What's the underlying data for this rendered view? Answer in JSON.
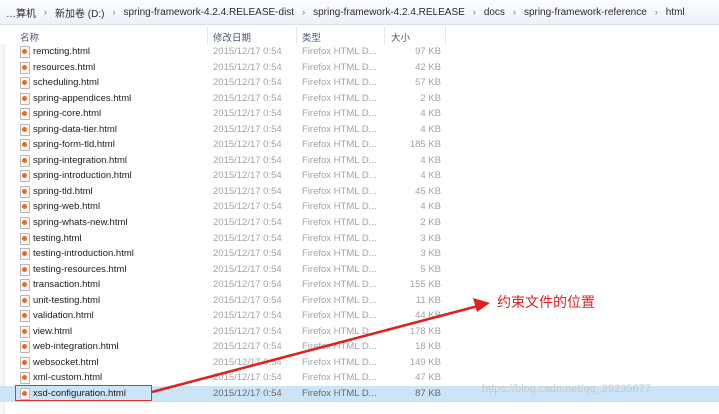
{
  "address_bar": {
    "crumbs": [
      "…算机",
      "新加卷 (D:)",
      "spring-framework-4.2.4.RELEASE-dist",
      "spring-framework-4.2.4.RELEASE",
      "docs",
      "spring-framework-reference",
      "html"
    ]
  },
  "columns": {
    "name": "名称",
    "date": "修改日期",
    "type": "类型",
    "size": "大小"
  },
  "files": [
    {
      "name": "remcting.html",
      "date": "2015/12/17 0:54",
      "type": "Firefox HTML D...",
      "size": "97 KB"
    },
    {
      "name": "resources.html",
      "date": "2015/12/17 0:54",
      "type": "Firefox HTML D...",
      "size": "42 KB"
    },
    {
      "name": "scheduling.html",
      "date": "2015/12/17 0:54",
      "type": "Firefox HTML D...",
      "size": "57 KB"
    },
    {
      "name": "spring-appendices.html",
      "date": "2015/12/17 0:54",
      "type": "Firefox HTML D...",
      "size": "2 KB"
    },
    {
      "name": "spring-core.html",
      "date": "2015/12/17 0:54",
      "type": "Firefox HTML D...",
      "size": "4 KB"
    },
    {
      "name": "spring-data-tier.html",
      "date": "2015/12/17 0:54",
      "type": "Firefox HTML D...",
      "size": "4 KB"
    },
    {
      "name": "spring-form-tld.html",
      "date": "2015/12/17 0:54",
      "type": "Firefox HTML D...",
      "size": "185 KB"
    },
    {
      "name": "spring-integration.html",
      "date": "2015/12/17 0:54",
      "type": "Firefox HTML D...",
      "size": "4 KB"
    },
    {
      "name": "spring-introduction.html",
      "date": "2015/12/17 0:54",
      "type": "Firefox HTML D...",
      "size": "4 KB"
    },
    {
      "name": "spring-tld.html",
      "date": "2015/12/17 0:54",
      "type": "Firefox HTML D...",
      "size": "45 KB"
    },
    {
      "name": "spring-web.html",
      "date": "2015/12/17 0:54",
      "type": "Firefox HTML D...",
      "size": "4 KB"
    },
    {
      "name": "spring-whats-new.html",
      "date": "2015/12/17 0:54",
      "type": "Firefox HTML D...",
      "size": "2 KB"
    },
    {
      "name": "testing.html",
      "date": "2015/12/17 0:54",
      "type": "Firefox HTML D...",
      "size": "3 KB"
    },
    {
      "name": "testing-introduction.html",
      "date": "2015/12/17 0:54",
      "type": "Firefox HTML D...",
      "size": "3 KB"
    },
    {
      "name": "testing-resources.html",
      "date": "2015/12/17 0:54",
      "type": "Firefox HTML D...",
      "size": "5 KB"
    },
    {
      "name": "transaction.html",
      "date": "2015/12/17 0:54",
      "type": "Firefox HTML D...",
      "size": "155 KB"
    },
    {
      "name": "unit-testing.html",
      "date": "2015/12/17 0:54",
      "type": "Firefox HTML D...",
      "size": "11 KB"
    },
    {
      "name": "validation.html",
      "date": "2015/12/17 0:54",
      "type": "Firefox HTML D...",
      "size": "44 KB"
    },
    {
      "name": "view.html",
      "date": "2015/12/17 0:54",
      "type": "Firefox HTML D...",
      "size": "178 KB"
    },
    {
      "name": "web-integration.html",
      "date": "2015/12/17 0:54",
      "type": "Firefox HTML D...",
      "size": "18 KB"
    },
    {
      "name": "websocket.html",
      "date": "2015/12/17 0:54",
      "type": "Firefox HTML D...",
      "size": "149 KB"
    },
    {
      "name": "xml-custom.html",
      "date": "2015/12/17 0:54",
      "type": "Firefox HTML D...",
      "size": "47 KB"
    },
    {
      "name": "xsd-configuration.html",
      "date": "2015/12/17 0:54",
      "type": "Firefox HTML D...",
      "size": "87 KB",
      "selected": true
    }
  ],
  "annotation": {
    "text": "约束文件的位置",
    "color": "#e01f1f"
  },
  "watermark": "https://blog.csdn.net/qq_29235677",
  "icons": {
    "file": "firefox-html-file-icon"
  }
}
